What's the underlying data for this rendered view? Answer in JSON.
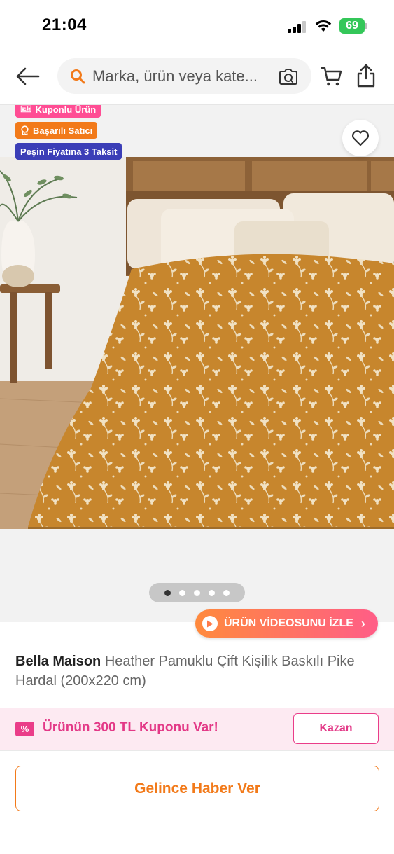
{
  "status_bar": {
    "time": "21:04",
    "battery": "69"
  },
  "header": {
    "search_placeholder": "Marka, ürün veya kate..."
  },
  "gallery": {
    "badges": {
      "coupon": "Kuponlu Ürün",
      "seller": "Başarılı Satıcı",
      "installment": "Peşin Fiyatına 3 Taksit"
    },
    "slide_count": 5,
    "active_slide": 1,
    "video_label": "ÜRÜN VİDEOSUNU İZLE"
  },
  "product": {
    "brand": "Bella Maison",
    "name": "Heather Pamuklu Çift Kişilik Baskılı Pike Hardal (200x220 cm)"
  },
  "coupon": {
    "icon_text": "%",
    "text": "Ürünün 300 TL Kuponu Var!",
    "button": "Kazan"
  },
  "cta": {
    "notify": "Gelince Haber Ver"
  },
  "colors": {
    "primary": "#f27a1a",
    "coupon": "#e33987",
    "installment": "#3b3eb7",
    "battery": "#34c759"
  }
}
